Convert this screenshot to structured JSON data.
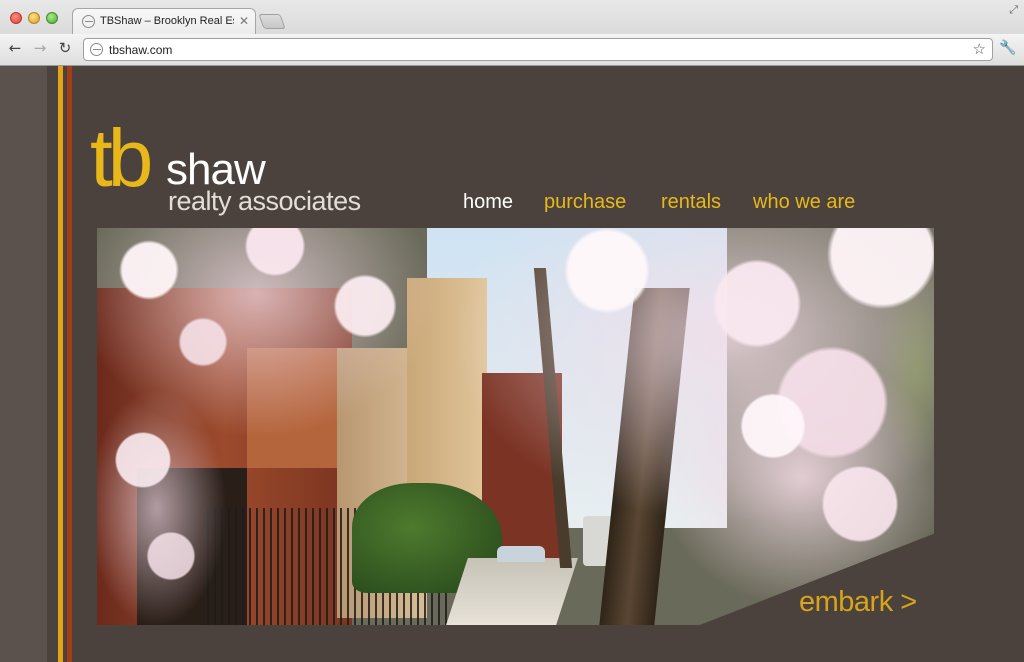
{
  "browser": {
    "tab_title": "TBShaw – Brooklyn Real Estate",
    "tab_close": "✕",
    "url": "tbshaw.com",
    "back_glyph": "←",
    "forward_glyph": "→",
    "reload_glyph": "↻",
    "star_glyph": "☆",
    "wrench_glyph": "🔧",
    "fullscreen_glyph": "⤢"
  },
  "logo": {
    "tb": "tb",
    "shaw": "shaw",
    "subtitle": "realty associates"
  },
  "nav": {
    "home": "home",
    "purchase": "purchase",
    "rentals": "rentals",
    "who_we_are": "who we are"
  },
  "hero": {
    "cta": "embark >"
  },
  "colors": {
    "background": "#4b423d",
    "accent_gold": "#e8b81a",
    "accent_red": "#a43c18",
    "nav_active": "#ffffff"
  },
  "icons": [
    "globe-icon",
    "back-arrow-icon",
    "forward-arrow-icon",
    "reload-icon",
    "star-icon",
    "wrench-icon",
    "close-icon"
  ]
}
